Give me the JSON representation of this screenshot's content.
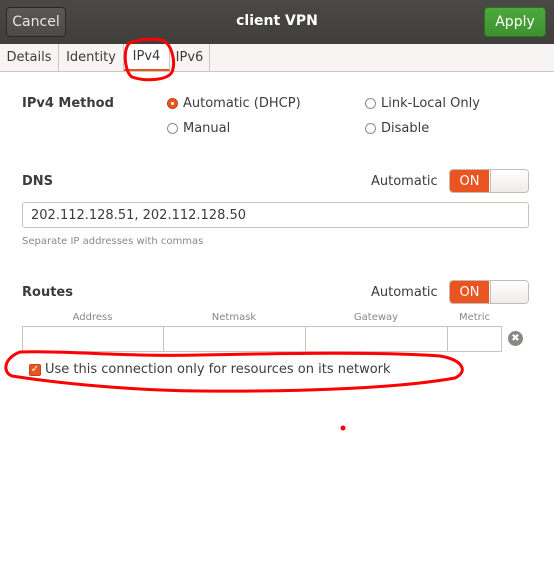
{
  "header": {
    "cancel_label": "Cancel",
    "title": "client VPN",
    "apply_label": "Apply"
  },
  "tabs": [
    {
      "label": "Details",
      "active": false
    },
    {
      "label": "Identity",
      "active": false
    },
    {
      "label": "IPv4",
      "active": true
    },
    {
      "label": "IPv6",
      "active": false
    }
  ],
  "ipv4_method": {
    "label": "IPv4 Method",
    "options": [
      {
        "label": "Automatic (DHCP)",
        "checked": true
      },
      {
        "label": "Link-Local Only",
        "checked": false
      },
      {
        "label": "Manual",
        "checked": false
      },
      {
        "label": "Disable",
        "checked": false
      }
    ]
  },
  "dns": {
    "label": "DNS",
    "automatic_label": "Automatic",
    "toggle_label": "ON",
    "value": "202.112.128.51, 202.112.128.50",
    "hint": "Separate IP addresses with commas"
  },
  "routes": {
    "label": "Routes",
    "automatic_label": "Automatic",
    "toggle_label": "ON",
    "columns": [
      "Address",
      "Netmask",
      "Gateway",
      "Metric"
    ],
    "clear_icon": "✖",
    "only_resources_label": "Use this connection only for resources on its network",
    "only_resources_checked": true,
    "check_mark": "✓"
  },
  "colors": {
    "accent": "#e95420",
    "apply_green": "#3e9130",
    "header_bg": "#3f3e3b",
    "annotation_red": "#ff0000"
  }
}
